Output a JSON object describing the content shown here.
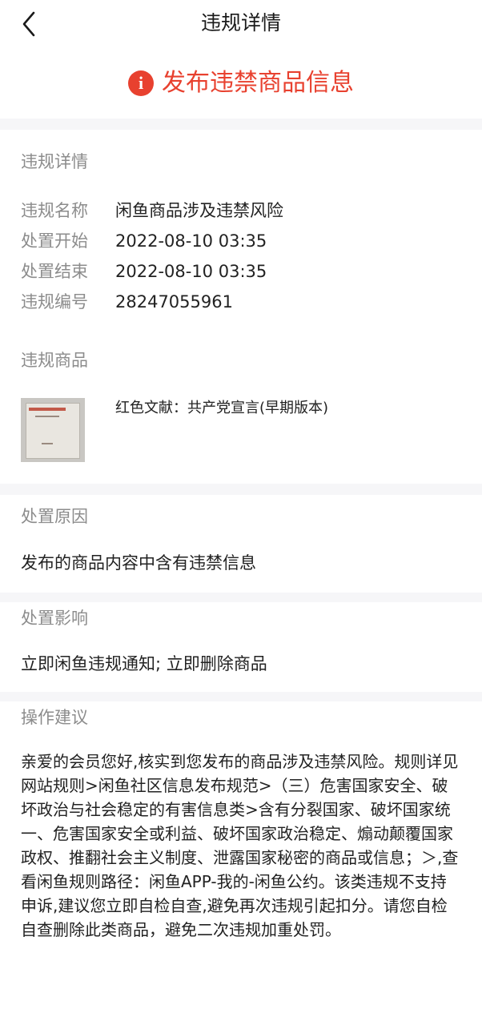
{
  "header": {
    "title": "违规详情"
  },
  "status": {
    "icon": "alert-icon",
    "icon_glyph": "i",
    "text": "发布违禁商品信息",
    "color": "#e8412f"
  },
  "details": {
    "section_title": "违规详情",
    "rows": [
      {
        "label": "违规名称",
        "value": "闲鱼商品涉及违禁风险"
      },
      {
        "label": "处置开始",
        "value": "2022-08-10 03:35"
      },
      {
        "label": "处置结束",
        "value": "2022-08-10 03:35"
      },
      {
        "label": "违规编号",
        "value": "28247055961"
      }
    ]
  },
  "product": {
    "section_title": "违规商品",
    "name": "红色文献：共产党宣言(早期版本)"
  },
  "reason": {
    "section_title": "处置原因",
    "text": "发布的商品内容中含有违禁信息"
  },
  "impact": {
    "section_title": "处置影响",
    "text": "立即闲鱼违规通知; 立即删除商品"
  },
  "advice": {
    "section_title": "操作建议",
    "text": "亲爱的会员您好,核实到您发布的商品涉及违禁风险。规则详见 网站规则>闲鱼社区信息发布规范>（三）危害国家安全、破坏政治与社会稳定的有害信息类>含有分裂国家、破坏国家统一、危害国家安全或利益、破坏国家政治稳定、煽动颠覆国家政权、推翻社会主义制度、泄露国家秘密的商品或信息；＞,查看闲鱼规则路径：闲鱼APP-我的-闲鱼公约。该类违规不支持申诉,建议您立即自检自查,避免再次违规引起扣分。请您自检自查删除此类商品，避免二次违规加重处罚。"
  }
}
